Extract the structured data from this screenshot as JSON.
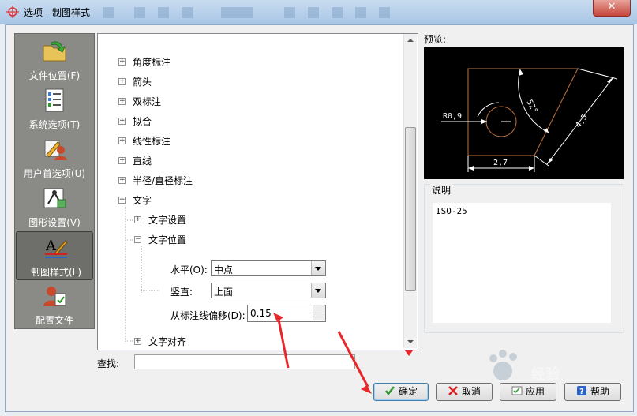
{
  "window": {
    "title": "选项 - 制图样式",
    "close_label": "✕"
  },
  "sidebar": {
    "items": [
      {
        "label": "文件位置(F)",
        "icon": "folder-arrow-icon"
      },
      {
        "label": "系统选项(T)",
        "icon": "checklist-icon"
      },
      {
        "label": "用户首选项(U)",
        "icon": "user-pencil-icon"
      },
      {
        "label": "图形设置(V)",
        "icon": "graphics-settings-icon"
      },
      {
        "label": "制图样式(L)",
        "icon": "drafting-style-icon",
        "active": true
      },
      {
        "label": "配置文件",
        "icon": "profile-icon"
      }
    ]
  },
  "tree": {
    "items": [
      {
        "label": "角度标注",
        "expander": "+"
      },
      {
        "label": "箭头",
        "expander": "+"
      },
      {
        "label": "双标注",
        "expander": "+"
      },
      {
        "label": "拟合",
        "expander": "+"
      },
      {
        "label": "线性标注",
        "expander": "+"
      },
      {
        "label": "直线",
        "expander": "+"
      },
      {
        "label": "半径/直径标注",
        "expander": "+"
      },
      {
        "label": "文字",
        "expander": "−"
      },
      {
        "label": "文字设置",
        "expander": "+"
      },
      {
        "label": "文字位置",
        "expander": "−"
      },
      {
        "label": "文字对齐",
        "expander": "+"
      }
    ],
    "horizontal_label": "水平(O):",
    "horizontal_value": "中点",
    "vertical_label": "竖直:",
    "vertical_value": "上面",
    "offset_label": "从标注线偏移(D):",
    "offset_value": "0.15"
  },
  "search": {
    "label": "查找:",
    "value": ""
  },
  "preview": {
    "label": "预览:",
    "radius_text": "R0,9",
    "angle_text": "52°",
    "length_text": "4,5",
    "width_text": "2,7"
  },
  "description": {
    "label": "说明",
    "text": "ISO-25"
  },
  "buttons": {
    "ok": "确定",
    "cancel": "取消",
    "apply": "应用",
    "help": "帮助"
  },
  "watermark": {
    "text": "经验"
  },
  "colors": {
    "arrow_red": "#e8272b",
    "preview_bg": "#000000",
    "preview_outline": "#c2723a"
  }
}
